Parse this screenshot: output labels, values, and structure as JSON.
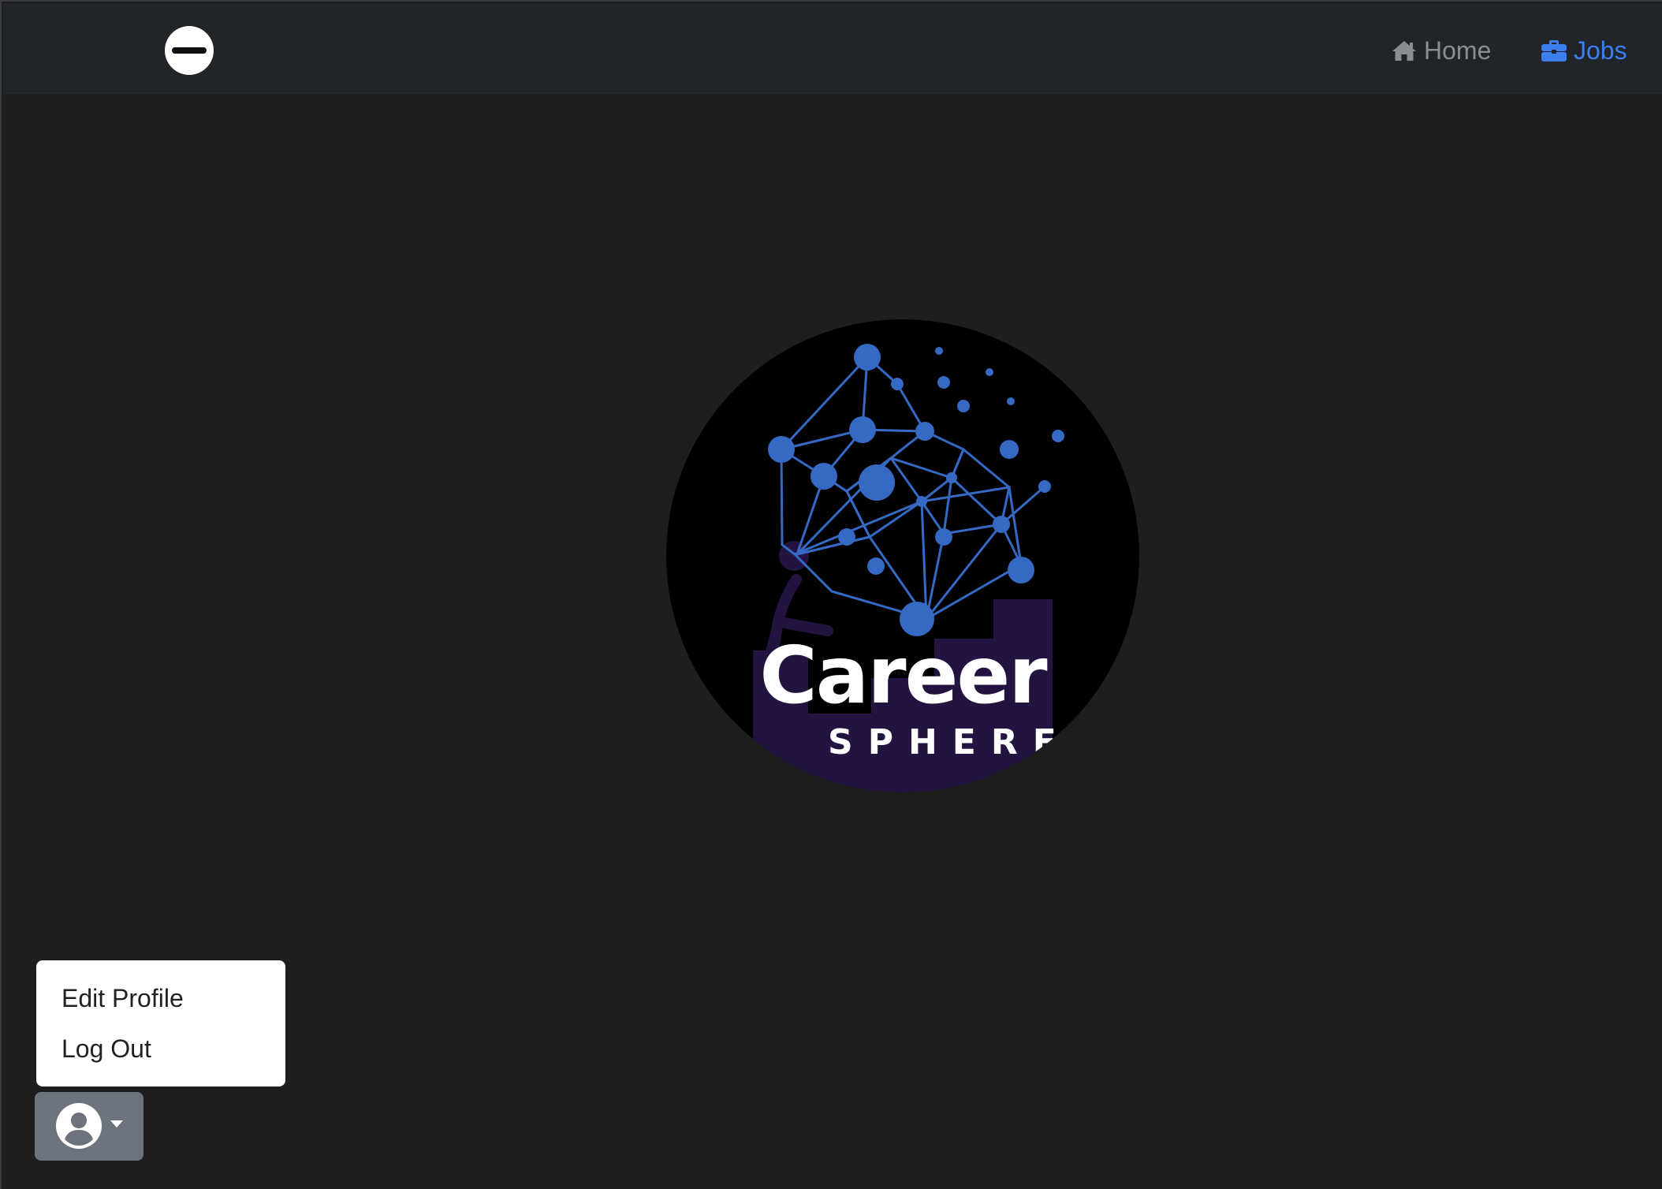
{
  "navbar": {
    "brand_icon": "minus-circle-icon",
    "links": [
      {
        "label": "Home",
        "icon": "home-icon",
        "color": "#8a8d92",
        "active": false
      },
      {
        "label": "Jobs",
        "icon": "briefcase-icon",
        "color": "#3b7ff0",
        "active": true
      }
    ]
  },
  "hero": {
    "logo": {
      "title": "Career",
      "subtitle": "SPHERE",
      "colors": {
        "network": "#3569c4",
        "figure": "#231340",
        "background": "#000000"
      }
    }
  },
  "user_menu": {
    "avatar_icon": "user-circle-icon",
    "caret_icon": "caret-down-icon",
    "items": [
      {
        "label": "Edit Profile"
      },
      {
        "label": "Log Out"
      }
    ]
  },
  "theme": {
    "page_bg": "#1e1e1f",
    "navbar_bg": "#212429",
    "toggle_bg": "#6c737c",
    "accent": "#3b7ff0"
  }
}
